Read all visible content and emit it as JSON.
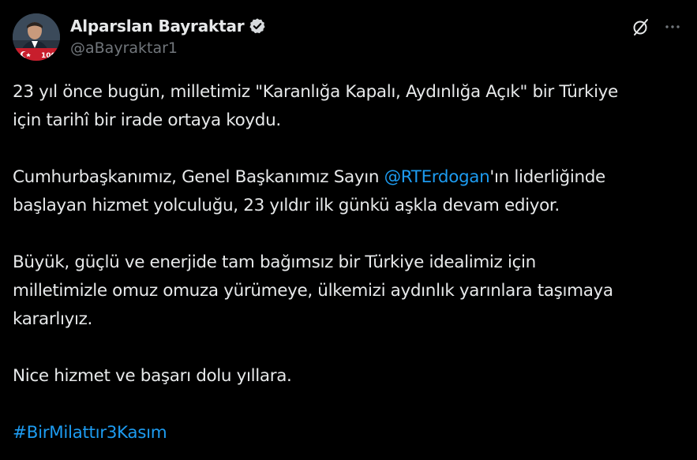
{
  "author": {
    "display_name": "Alparslan Bayraktar",
    "handle": "@aBayraktar1",
    "verified": true
  },
  "header_actions": {
    "grok_icon": "grok-slash-circle-icon",
    "more_icon": "more-horizontal-icon"
  },
  "post": {
    "p1": "23 yıl önce bugün, milletimiz \"Karanlığa Kapalı, Aydınlığa Açık\" bir Türkiye\niçin tarihî bir irade ortaya koydu.",
    "p2_before": "Cumhurbaşkanımız, Genel Başkanımız Sayın ",
    "p2_mention": "@RTErdogan",
    "p2_after": "'ın liderliğinde\nbaşlayan hizmet yolculuğu, 23 yıldır ilk günkü aşkla devam ediyor.",
    "p3": "Büyük, güçlü ve enerjide tam bağımsız bir Türkiye idealimiz için\nmilletimizle omuz omuza yürümeye, ülkemizi aydınlık yarınlara taşımaya\nkararlıyız.",
    "p4": "Nice hizmet ve başarı dolu yıllara.",
    "hashtag": "#BirMilattır3Kasım"
  },
  "colors": {
    "background": "#000000",
    "text": "#e7e9ea",
    "secondary": "#71767b",
    "link": "#1d9bf0"
  }
}
